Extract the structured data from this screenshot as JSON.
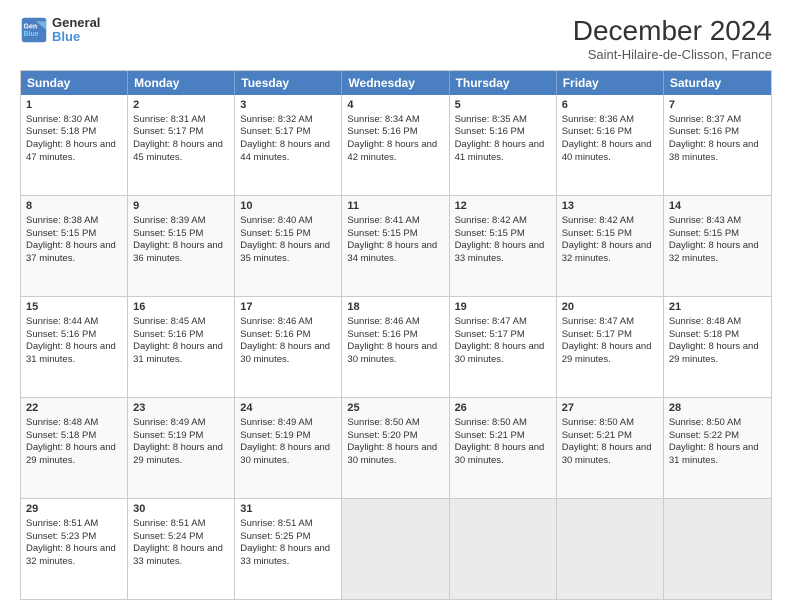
{
  "logo": {
    "line1": "General",
    "line2": "Blue"
  },
  "title": "December 2024",
  "subtitle": "Saint-Hilaire-de-Clisson, France",
  "days_of_week": [
    "Sunday",
    "Monday",
    "Tuesday",
    "Wednesday",
    "Thursday",
    "Friday",
    "Saturday"
  ],
  "weeks": [
    [
      {
        "day": 1,
        "sunrise": "Sunrise: 8:30 AM",
        "sunset": "Sunset: 5:18 PM",
        "daylight": "Daylight: 8 hours and 47 minutes."
      },
      {
        "day": 2,
        "sunrise": "Sunrise: 8:31 AM",
        "sunset": "Sunset: 5:17 PM",
        "daylight": "Daylight: 8 hours and 45 minutes."
      },
      {
        "day": 3,
        "sunrise": "Sunrise: 8:32 AM",
        "sunset": "Sunset: 5:17 PM",
        "daylight": "Daylight: 8 hours and 44 minutes."
      },
      {
        "day": 4,
        "sunrise": "Sunrise: 8:34 AM",
        "sunset": "Sunset: 5:16 PM",
        "daylight": "Daylight: 8 hours and 42 minutes."
      },
      {
        "day": 5,
        "sunrise": "Sunrise: 8:35 AM",
        "sunset": "Sunset: 5:16 PM",
        "daylight": "Daylight: 8 hours and 41 minutes."
      },
      {
        "day": 6,
        "sunrise": "Sunrise: 8:36 AM",
        "sunset": "Sunset: 5:16 PM",
        "daylight": "Daylight: 8 hours and 40 minutes."
      },
      {
        "day": 7,
        "sunrise": "Sunrise: 8:37 AM",
        "sunset": "Sunset: 5:16 PM",
        "daylight": "Daylight: 8 hours and 38 minutes."
      }
    ],
    [
      {
        "day": 8,
        "sunrise": "Sunrise: 8:38 AM",
        "sunset": "Sunset: 5:15 PM",
        "daylight": "Daylight: 8 hours and 37 minutes."
      },
      {
        "day": 9,
        "sunrise": "Sunrise: 8:39 AM",
        "sunset": "Sunset: 5:15 PM",
        "daylight": "Daylight: 8 hours and 36 minutes."
      },
      {
        "day": 10,
        "sunrise": "Sunrise: 8:40 AM",
        "sunset": "Sunset: 5:15 PM",
        "daylight": "Daylight: 8 hours and 35 minutes."
      },
      {
        "day": 11,
        "sunrise": "Sunrise: 8:41 AM",
        "sunset": "Sunset: 5:15 PM",
        "daylight": "Daylight: 8 hours and 34 minutes."
      },
      {
        "day": 12,
        "sunrise": "Sunrise: 8:42 AM",
        "sunset": "Sunset: 5:15 PM",
        "daylight": "Daylight: 8 hours and 33 minutes."
      },
      {
        "day": 13,
        "sunrise": "Sunrise: 8:42 AM",
        "sunset": "Sunset: 5:15 PM",
        "daylight": "Daylight: 8 hours and 32 minutes."
      },
      {
        "day": 14,
        "sunrise": "Sunrise: 8:43 AM",
        "sunset": "Sunset: 5:15 PM",
        "daylight": "Daylight: 8 hours and 32 minutes."
      }
    ],
    [
      {
        "day": 15,
        "sunrise": "Sunrise: 8:44 AM",
        "sunset": "Sunset: 5:16 PM",
        "daylight": "Daylight: 8 hours and 31 minutes."
      },
      {
        "day": 16,
        "sunrise": "Sunrise: 8:45 AM",
        "sunset": "Sunset: 5:16 PM",
        "daylight": "Daylight: 8 hours and 31 minutes."
      },
      {
        "day": 17,
        "sunrise": "Sunrise: 8:46 AM",
        "sunset": "Sunset: 5:16 PM",
        "daylight": "Daylight: 8 hours and 30 minutes."
      },
      {
        "day": 18,
        "sunrise": "Sunrise: 8:46 AM",
        "sunset": "Sunset: 5:16 PM",
        "daylight": "Daylight: 8 hours and 30 minutes."
      },
      {
        "day": 19,
        "sunrise": "Sunrise: 8:47 AM",
        "sunset": "Sunset: 5:17 PM",
        "daylight": "Daylight: 8 hours and 30 minutes."
      },
      {
        "day": 20,
        "sunrise": "Sunrise: 8:47 AM",
        "sunset": "Sunset: 5:17 PM",
        "daylight": "Daylight: 8 hours and 29 minutes."
      },
      {
        "day": 21,
        "sunrise": "Sunrise: 8:48 AM",
        "sunset": "Sunset: 5:18 PM",
        "daylight": "Daylight: 8 hours and 29 minutes."
      }
    ],
    [
      {
        "day": 22,
        "sunrise": "Sunrise: 8:48 AM",
        "sunset": "Sunset: 5:18 PM",
        "daylight": "Daylight: 8 hours and 29 minutes."
      },
      {
        "day": 23,
        "sunrise": "Sunrise: 8:49 AM",
        "sunset": "Sunset: 5:19 PM",
        "daylight": "Daylight: 8 hours and 29 minutes."
      },
      {
        "day": 24,
        "sunrise": "Sunrise: 8:49 AM",
        "sunset": "Sunset: 5:19 PM",
        "daylight": "Daylight: 8 hours and 30 minutes."
      },
      {
        "day": 25,
        "sunrise": "Sunrise: 8:50 AM",
        "sunset": "Sunset: 5:20 PM",
        "daylight": "Daylight: 8 hours and 30 minutes."
      },
      {
        "day": 26,
        "sunrise": "Sunrise: 8:50 AM",
        "sunset": "Sunset: 5:21 PM",
        "daylight": "Daylight: 8 hours and 30 minutes."
      },
      {
        "day": 27,
        "sunrise": "Sunrise: 8:50 AM",
        "sunset": "Sunset: 5:21 PM",
        "daylight": "Daylight: 8 hours and 30 minutes."
      },
      {
        "day": 28,
        "sunrise": "Sunrise: 8:50 AM",
        "sunset": "Sunset: 5:22 PM",
        "daylight": "Daylight: 8 hours and 31 minutes."
      }
    ],
    [
      {
        "day": 29,
        "sunrise": "Sunrise: 8:51 AM",
        "sunset": "Sunset: 5:23 PM",
        "daylight": "Daylight: 8 hours and 32 minutes."
      },
      {
        "day": 30,
        "sunrise": "Sunrise: 8:51 AM",
        "sunset": "Sunset: 5:24 PM",
        "daylight": "Daylight: 8 hours and 33 minutes."
      },
      {
        "day": 31,
        "sunrise": "Sunrise: 8:51 AM",
        "sunset": "Sunset: 5:25 PM",
        "daylight": "Daylight: 8 hours and 33 minutes."
      },
      null,
      null,
      null,
      null
    ]
  ]
}
